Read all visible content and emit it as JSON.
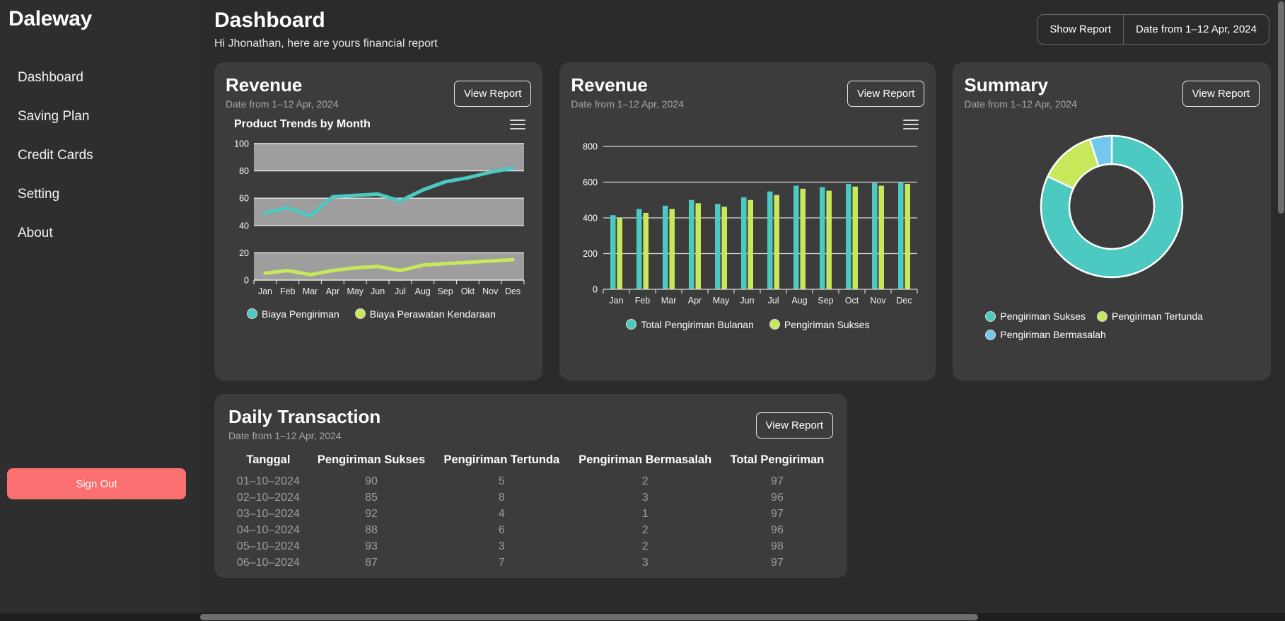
{
  "brand": "Daleway",
  "sidebar": {
    "items": [
      {
        "label": "Dashboard"
      },
      {
        "label": "Saving Plan"
      },
      {
        "label": "Credit Cards"
      },
      {
        "label": "Setting"
      },
      {
        "label": "About"
      }
    ],
    "sign_out": "Sign Out"
  },
  "header": {
    "title": "Dashboard",
    "subtitle": "Hi Jhonathan, here are yours financial report",
    "show_report": "Show Report",
    "date_range": "Date from 1–12 Apr, 2024"
  },
  "cards": {
    "revenue_line": {
      "title": "Revenue",
      "date": "Date from 1–12 Apr, 2024",
      "view_report": "View Report"
    },
    "revenue_bar": {
      "title": "Revenue",
      "date": "Date from 1–12 Apr, 2024",
      "view_report": "View Report"
    },
    "summary": {
      "title": "Summary",
      "date": "Date from 1–12 Apr, 2024",
      "view_report": "View Report"
    }
  },
  "colors": {
    "teal": "#4cc9c0",
    "green": "#c6e85a",
    "blue": "#72c8ec",
    "accent_red": "#fa6f6f",
    "card_bg": "#3c3c3c",
    "page_bg": "#2e2e2e",
    "band_gray": "#9e9e9e"
  },
  "chart_data": [
    {
      "type": "line",
      "title": "Product Trends by Month",
      "xlabel": "",
      "ylabel": "",
      "ylim": [
        0,
        100
      ],
      "yticks": [
        0,
        20,
        40,
        60,
        80,
        100
      ],
      "grid": true,
      "legend_position": "bottom",
      "categories": [
        "Jan",
        "Feb",
        "Mar",
        "Apr",
        "May",
        "Jun",
        "Jul",
        "Aug",
        "Sep",
        "Okt",
        "Nov",
        "Des"
      ],
      "series": [
        {
          "name": "Biaya Pengiriman",
          "color": "#4cc9c0",
          "values": [
            49,
            53,
            47,
            61,
            62,
            63,
            58,
            66,
            72,
            75,
            79,
            82
          ]
        },
        {
          "name": "Biaya Perawatan Kendaraan",
          "color": "#c6e85a",
          "values": [
            5,
            7,
            4,
            7,
            9,
            10,
            7,
            11,
            12,
            13,
            14,
            15
          ]
        }
      ]
    },
    {
      "type": "bar",
      "title": "",
      "xlabel": "",
      "ylabel": "",
      "ylim": [
        0,
        800
      ],
      "yticks": [
        0,
        200,
        400,
        600,
        800
      ],
      "grid": true,
      "legend_position": "bottom",
      "categories": [
        "Jan",
        "Feb",
        "Mar",
        "Apr",
        "May",
        "Jun",
        "Jul",
        "Aug",
        "Sep",
        "Oct",
        "Nov",
        "Dec"
      ],
      "series": [
        {
          "name": "Total Pengiriman Bulanan",
          "color": "#4cc9c0",
          "values": [
            415,
            450,
            468,
            500,
            478,
            515,
            548,
            580,
            572,
            590,
            595,
            600
          ]
        },
        {
          "name": "Pengiriman Sukses",
          "color": "#c6e85a",
          "values": [
            398,
            428,
            450,
            482,
            462,
            500,
            528,
            563,
            552,
            575,
            580,
            590
          ]
        }
      ]
    },
    {
      "type": "pie",
      "title": "Summary",
      "legend_position": "bottom",
      "labels": [
        "Pengiriman Sukses",
        "Pengiriman Tertunda",
        "Pengiriman Bermasalah"
      ],
      "colors": [
        "#4cc9c0",
        "#c6e85a",
        "#72c8ec"
      ],
      "values": [
        82,
        13,
        5
      ]
    }
  ],
  "daily_transaction": {
    "title": "Daily Transaction",
    "date": "Date from 1–12 Apr, 2024",
    "view_report": "View Report",
    "columns": [
      "Tanggal",
      "Pengiriman Sukses",
      "Pengiriman Tertunda",
      "Pengiriman Bermasalah",
      "Total Pengiriman"
    ],
    "rows": [
      [
        "01–10–2024",
        "90",
        "5",
        "2",
        "97"
      ],
      [
        "02–10–2024",
        "85",
        "8",
        "3",
        "96"
      ],
      [
        "03–10–2024",
        "92",
        "4",
        "1",
        "97"
      ],
      [
        "04–10–2024",
        "88",
        "6",
        "2",
        "96"
      ],
      [
        "05–10–2024",
        "93",
        "3",
        "2",
        "98"
      ],
      [
        "06–10–2024",
        "87",
        "7",
        "3",
        "97"
      ]
    ]
  },
  "icons": {
    "menu": "hamburger-menu-icon"
  }
}
